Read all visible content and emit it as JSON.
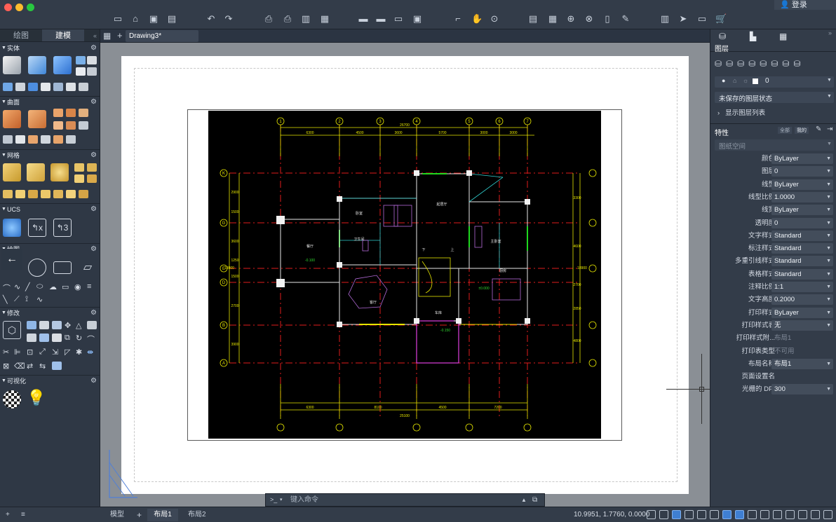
{
  "topbar": {
    "login_label": "登录"
  },
  "left_panel": {
    "tabs": [
      {
        "label": "绘图"
      },
      {
        "label": "建模"
      }
    ],
    "sections": [
      {
        "title": "实体"
      },
      {
        "title": "曲面"
      },
      {
        "title": "网格"
      },
      {
        "title": "UCS"
      },
      {
        "title": "绘图"
      },
      {
        "title": "修改"
      },
      {
        "title": "可视化"
      }
    ]
  },
  "doc_tabs": {
    "active": "Drawing3*"
  },
  "command_line": {
    "prompt": ">_",
    "placeholder": "键入命令"
  },
  "layout_tabs": {
    "model": "模型",
    "tabs": [
      "布局1",
      "布局2"
    ]
  },
  "status_bar": {
    "coords": "10.9951, 1.7760, 0.0000"
  },
  "right_panel": {
    "layers_title": "图层",
    "current_layer": "0",
    "layer_state": "未保存的图层状态",
    "show_layer_list": "显示图层列表",
    "props_title": "特性",
    "props_btns": [
      "全部",
      "我的"
    ],
    "space_label": "图纸空间",
    "properties": [
      {
        "label": "颜色",
        "value": "ByLayer",
        "editable": true
      },
      {
        "label": "图层",
        "value": "0",
        "editable": true
      },
      {
        "label": "线型",
        "value": "ByLayer",
        "editable": true
      },
      {
        "label": "线型比例",
        "value": "1.0000",
        "editable": true
      },
      {
        "label": "线宽",
        "value": "ByLayer",
        "editable": true
      },
      {
        "label": "透明度",
        "value": "0",
        "editable": true
      },
      {
        "label": "文字样式",
        "value": "Standard",
        "editable": true
      },
      {
        "label": "标注样式",
        "value": "Standard",
        "editable": true
      },
      {
        "label": "多重引线样式",
        "value": "Standard",
        "editable": true
      },
      {
        "label": "表格样式",
        "value": "Standard",
        "editable": true
      },
      {
        "label": "注释比例",
        "value": "1:1",
        "editable": true
      },
      {
        "label": "文字高度",
        "value": "0.2000",
        "editable": true
      },
      {
        "label": "打印样式",
        "value": "ByLayer",
        "editable": true
      },
      {
        "label": "打印样式表",
        "value": "无",
        "editable": true
      },
      {
        "label": "打印样式附...",
        "value": "布局1",
        "editable": false
      },
      {
        "label": "打印表类型",
        "value": "不可用",
        "editable": false
      },
      {
        "label": "布局名称",
        "value": "布局1",
        "editable": true
      },
      {
        "label": "页面设置名",
        "value": "",
        "editable": false
      },
      {
        "label": "光栅的 DPI",
        "value": "300",
        "editable": true
      }
    ]
  },
  "drawing": {
    "top_total": "26700",
    "bottom_total": "25100",
    "top_dims": [
      "6300",
      "4500",
      "3600",
      "5700",
      "3000",
      "3000"
    ],
    "bottom_dims": [
      "6300",
      "8100",
      "4500",
      "7200"
    ],
    "left_total": "18900",
    "left_dims": [
      "2900",
      "1500",
      "3600",
      "1250",
      "1500",
      "2700",
      "3900"
    ],
    "right_dims": [
      "3300",
      "4600",
      "2700",
      "2850",
      "4800"
    ],
    "right_total": "18900",
    "col_axes": [
      "1",
      "2",
      "3",
      "4",
      "5",
      "6",
      "7"
    ],
    "row_axes": [
      "K",
      "G",
      "E",
      "D",
      "B",
      "A"
    ],
    "room_labels": [
      "卧室",
      "卫生间",
      "客厅",
      "起居厅",
      "主卧室",
      "厨房",
      "餐厅",
      "车库",
      "下",
      "上"
    ],
    "levels": [
      "-0.100",
      "±0.000",
      "-0.150"
    ]
  }
}
